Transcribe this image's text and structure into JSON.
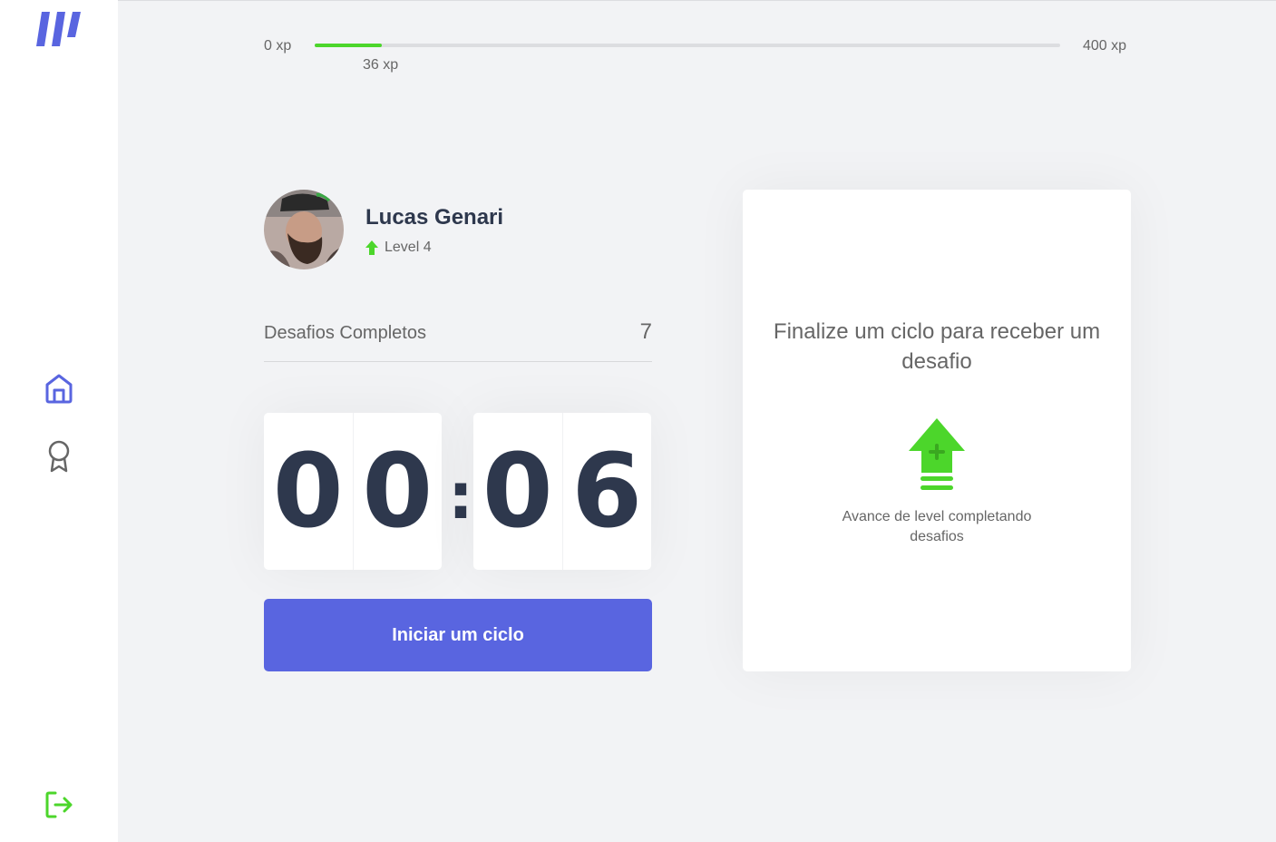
{
  "colors": {
    "brand": "#5965e0",
    "green": "#4cd62b",
    "title": "#2e384d",
    "text": "#666666",
    "background": "#f2f3f5"
  },
  "sidebar": {
    "logo_icon": "logo-icon",
    "nav": [
      {
        "name": "home",
        "icon": "home-icon",
        "active": true
      },
      {
        "name": "leaderboard",
        "icon": "award-icon",
        "active": false
      }
    ],
    "logout_icon": "logout-icon"
  },
  "xp_bar": {
    "min_label": "0 xp",
    "max_label": "400 xp",
    "current_label": "36 xp",
    "progress_fraction": 0.09
  },
  "profile": {
    "name": "Lucas Genari",
    "level_label": "Level 4",
    "level_icon": "level-up-arrow-icon"
  },
  "completed_challenges": {
    "label": "Desafios Completos",
    "count": "7"
  },
  "countdown": {
    "minute_left": "0",
    "minute_right": "0",
    "separator": ":",
    "second_left": "0",
    "second_right": "6"
  },
  "start_button": {
    "label": "Iniciar um ciclo"
  },
  "challenge_box": {
    "title": "Finalize um ciclo para receber um desafio",
    "icon": "level-up-icon",
    "text": "Avance de level completando desafios"
  }
}
